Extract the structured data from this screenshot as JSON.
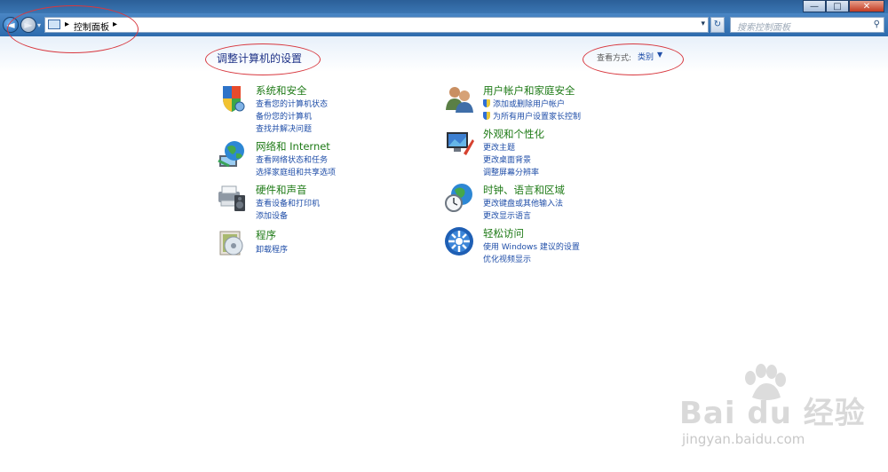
{
  "window": {
    "controls": {
      "minimize": "—",
      "maximize": "□",
      "close": "✕"
    }
  },
  "nav": {
    "back": "◄",
    "forward": "►",
    "history_drop": "▾",
    "address": {
      "icon": "control-panel-icon",
      "breadcrumb": [
        "控制面板"
      ],
      "sep": "▸",
      "drop": "▾"
    },
    "refresh": "↻",
    "search": {
      "placeholder": "搜索控制面板",
      "icon": "magnifier-icon"
    }
  },
  "content": {
    "title": "调整计算机的设置",
    "view_by_label": "查看方式:",
    "view_by_value": "类别",
    "view_drop": "▼",
    "categories": [
      {
        "icon": "system-security-icon",
        "title": "系统和安全",
        "links": [
          "查看您的计算机状态",
          "备份您的计算机",
          "查找并解决问题"
        ]
      },
      {
        "icon": "network-internet-icon",
        "title": "网络和 Internet",
        "links": [
          "查看网络状态和任务",
          "选择家庭组和共享选项"
        ]
      },
      {
        "icon": "hardware-sound-icon",
        "title": "硬件和声音",
        "links": [
          "查看设备和打印机",
          "添加设备"
        ]
      },
      {
        "icon": "programs-icon",
        "title": "程序",
        "links": [
          "卸载程序"
        ]
      },
      {
        "icon": "user-accounts-icon",
        "title": "用户帐户和家庭安全",
        "links": [
          "添加或删除用户帐户",
          "为所有用户设置家长控制"
        ]
      },
      {
        "icon": "appearance-icon",
        "title": "外观和个性化",
        "links": [
          "更改主题",
          "更改桌面背景",
          "调整屏幕分辨率"
        ]
      },
      {
        "icon": "clock-language-region-icon",
        "title": "时钟、语言和区域",
        "links": [
          "更改键盘或其他输入法",
          "更改显示语言"
        ]
      },
      {
        "icon": "ease-of-access-icon",
        "title": "轻松访问",
        "links": [
          "使用 Windows 建议的设置",
          "优化视频显示"
        ]
      }
    ]
  },
  "watermark": {
    "main": "Bai du 经验",
    "sub": "jingyan.baidu.com"
  },
  "colors": {
    "link": "#1f4ea8",
    "category_title": "#1e7a16",
    "page_title": "#1e3287",
    "annotation": "#d8383f"
  }
}
